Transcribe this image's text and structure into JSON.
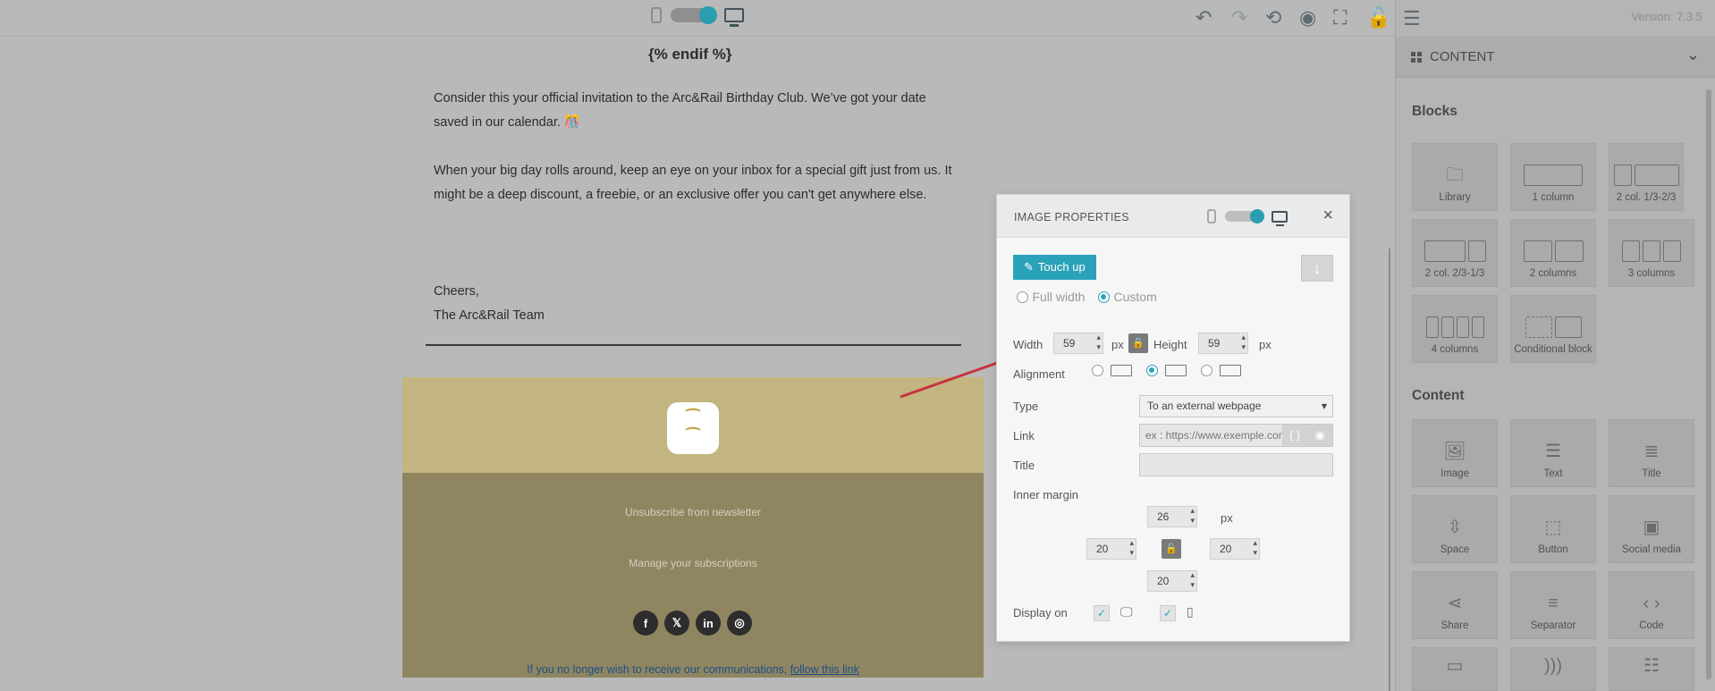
{
  "app": {
    "version": "Version: 7.3.5"
  },
  "toolbar": {
    "icons": [
      "undo-icon",
      "redo-icon",
      "history-icon",
      "preview-icon",
      "fullscreen-icon",
      "unlock-icon",
      "panel-toggle-icon"
    ]
  },
  "email": {
    "endif": "{% endif %}",
    "paragraph1": "Consider this your official invitation to the Arc&Rail Birthday Club. We’ve got your date saved in our calendar. 🎊",
    "paragraph2": "When your big day rolls around, keep an eye on your inbox for a special gift just from us. It might be a deep discount, a freebie, or an exclusive offer you can't get anywhere else.",
    "signoff1": "Cheers,",
    "signoff2": "The Arc&Rail Team",
    "footer": {
      "unsubscribe": "Unsubscribe from newsletter",
      "manage": "Manage your subscriptions",
      "social": [
        "f",
        "𝕏",
        "in",
        "◎"
      ]
    },
    "bottom_text": "If you no longer wish to receive our communications,",
    "bottom_link": "follow this link"
  },
  "modal": {
    "title": "IMAGE PROPERTIES",
    "touch_up": "Touch up",
    "full_width": "Full width",
    "custom": "Custom",
    "width_label": "Width",
    "width_value": "59",
    "height_label": "Height",
    "height_value": "59",
    "px": "px",
    "alignment_label": "Alignment",
    "type_label": "Type",
    "type_value": "To an external webpage",
    "link_label": "Link",
    "link_placeholder": "ex : https://www.exemple.com",
    "title_label": "Title",
    "inner_margin_label": "Inner margin",
    "margin_top": "26",
    "margin_left": "20",
    "margin_right": "20",
    "margin_bottom": "20",
    "display_on_label": "Display on"
  },
  "sidebar": {
    "header": "CONTENT",
    "blocks_title": "Blocks",
    "blocks": [
      "Library",
      "1 column",
      "2 col. 1/3-2/3",
      "2 col. 2/3-1/3",
      "2 columns",
      "3 columns",
      "4 columns",
      "Conditional block"
    ],
    "content_title": "Content",
    "content": [
      "Image",
      "Text",
      "Title",
      "Space",
      "Button",
      "Social media",
      "Share",
      "Separator",
      "Code"
    ]
  },
  "colors": {
    "accent": "#2aa3b8",
    "footer_top": "#c3b57f",
    "footer_bottom": "#8f8661",
    "arrow": "#c8323f"
  }
}
